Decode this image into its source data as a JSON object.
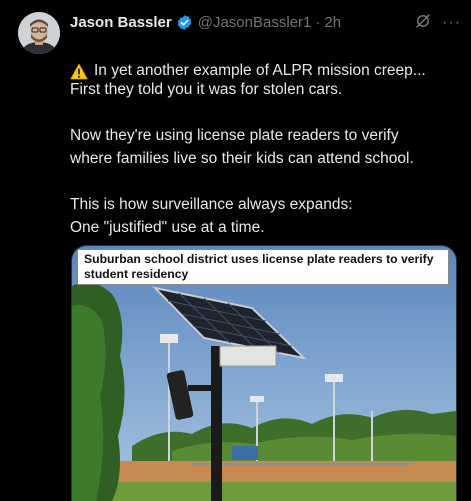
{
  "author": {
    "name": "Jason Bassler",
    "handle": "@JasonBassler1",
    "separator": "·",
    "time": "2h"
  },
  "icons": {
    "verified": "verified-badge-icon",
    "grok": "grok-icon",
    "more": "more-options-icon",
    "warning": "warning-icon"
  },
  "colors": {
    "verified": "#1d9bf0",
    "muted": "#71767b",
    "text": "#e7e9ea"
  },
  "tweet": {
    "first_line": "In yet another example of ALPR mission creep...",
    "paragraphs": [
      "First they told you it was for stolen cars.",
      "Now they're using license plate readers to verify\nwhere families live so their kids can attend school.",
      "This is how surveillance always expands:\nOne \"justified\" use at a time."
    ]
  },
  "media": {
    "headline": "Suburban school district uses license plate readers to verify student residency"
  },
  "ui": {
    "more_glyph": "···"
  }
}
